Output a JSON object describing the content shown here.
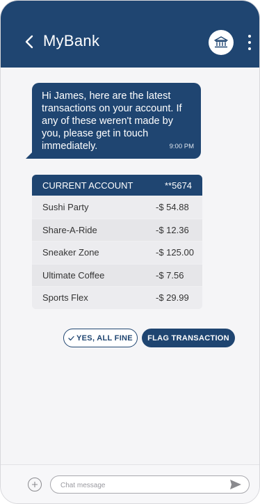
{
  "colors": {
    "primary": "#1f4571",
    "background": "#f5f5f7",
    "table_bg": "#e6e6e9"
  },
  "header": {
    "back_icon": "chevron-left-icon",
    "title": "MyBank",
    "bank_icon": "bank-icon",
    "menu_icon": "more-vertical-icon"
  },
  "message": {
    "text": "Hi James, here are the latest transactions on your account. If any of these weren't made by you, please get in touch immediately.",
    "time": "9:00 PM"
  },
  "account": {
    "name": "CURRENT ACCOUNT",
    "number": "**5674",
    "transactions": [
      {
        "merchant": "Sushi Party",
        "amount": "-$ 54.88"
      },
      {
        "merchant": "Share-A-Ride",
        "amount": "-$ 12.36"
      },
      {
        "merchant": "Sneaker Zone",
        "amount": "-$ 125.00"
      },
      {
        "merchant": "Ultimate Coffee",
        "amount": "-$ 7.56"
      },
      {
        "merchant": "Sports Flex",
        "amount": "-$ 29.99"
      }
    ]
  },
  "actions": {
    "yes_label": "YES, ALL FINE",
    "flag_label": "FLAG TRANSACTION"
  },
  "composer": {
    "add_icon": "plus-circle-icon",
    "placeholder": "Chat message",
    "send_icon": "send-icon"
  }
}
